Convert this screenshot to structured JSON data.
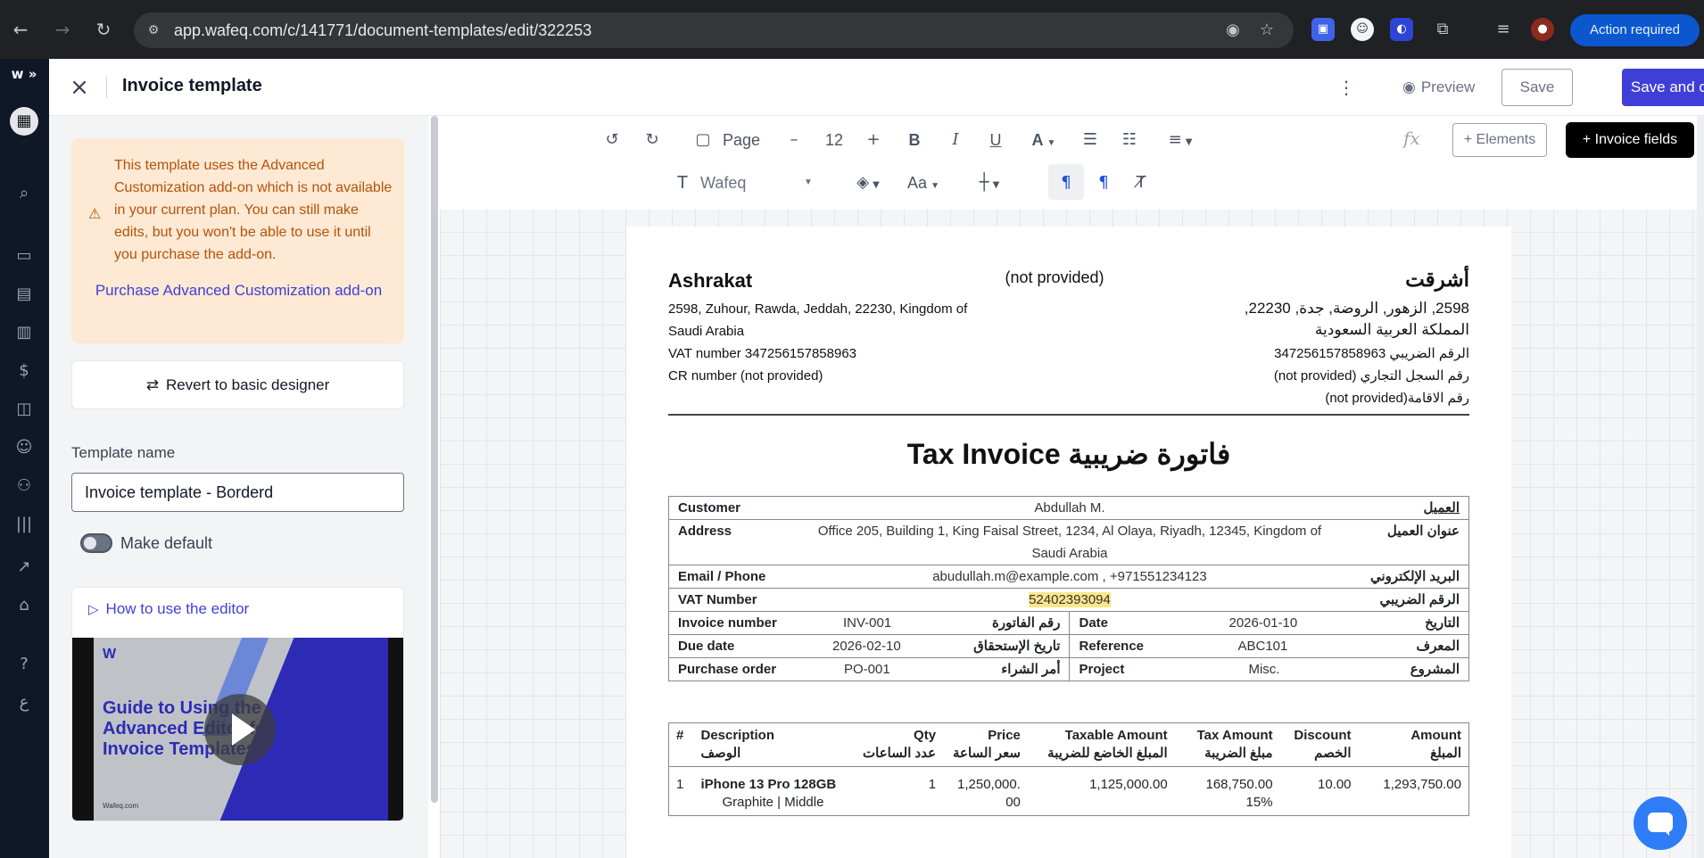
{
  "browser": {
    "url": "app.wafeq.com/c/141771/document-templates/edit/322253",
    "action_required": "Action required",
    "back_icon": "arrow-left-icon",
    "reload_icon": "reload-icon"
  },
  "header": {
    "title": "Invoice template",
    "preview_label": "Preview",
    "save_label": "Save",
    "save_close_label": "Save and close"
  },
  "sidebar": {
    "warning_text": "This template uses the Advanced Customization add-on which is not available in your current plan. You can still make edits, but you won't be able to use it until you purchase the add-on.",
    "purchase_link": "Purchase Advanced Customization add-on",
    "revert_label": "Revert to basic designer",
    "template_name_label": "Template name",
    "template_name_value": "Invoice template - Borderd",
    "make_default_label": "Make default",
    "make_default_on": false,
    "howto_label": "How to use the editor",
    "video_logo": "W",
    "video_title": "Guide to Using the Advanced Editor for Invoice Templates",
    "video_site": "Wafeq.com"
  },
  "toolbar": {
    "page_label": "Page",
    "font_size": "12",
    "font_family": "Wafeq",
    "case_label": "Aa",
    "elements_label": "+ Elements",
    "invoice_fields_label": "+ Invoice fields",
    "fx_label": "fx"
  },
  "doc": {
    "company_en": "Ashrakat",
    "company_ar": "أشرقت",
    "logo_placeholder": "(not provided)",
    "address_en_1": "2598, Zuhour, Rawda, Jeddah, 22230, Kingdom of",
    "address_en_2": "Saudi Arabia",
    "vat_en": "VAT number 347256157858963",
    "cr_en": "CR number (not provided)",
    "address_ar_1": "2598, الزهور, الروضة, جدة, 22230,",
    "address_ar_2": "المملكة العربية السعودية",
    "vat_ar": "الرقم الضريبي 347256157858963",
    "cr_ar": "رقم السجل التجاري (not provided)",
    "residency_ar": "رقم الاقامة(not provided)",
    "title": "Tax Invoice فاتورة ضريبية",
    "customer": {
      "label": "Customer",
      "label_ar": "العميل",
      "value": "Abdullah M."
    },
    "address": {
      "label": "Address",
      "label_ar": "عنوان العميل",
      "value": "Office 205, Building 1, King Faisal Street, 1234, Al Olaya, Riyadh, 12345, Kingdom of Saudi Arabia"
    },
    "email": {
      "label": "Email / Phone",
      "label_ar": "البريد الإلكتروني",
      "value": "abudullah.m@example.com , +971551234123"
    },
    "vat": {
      "label": "VAT Number",
      "label_ar": "الرقم الضريبي",
      "value": "52402393094"
    },
    "fields": [
      {
        "l": "Invoice number",
        "v": "INV-001",
        "la": "رقم الفاتورة",
        "l2": "Date",
        "v2": "2026-01-10",
        "la2": "التاريخ"
      },
      {
        "l": "Due date",
        "v": "2026-02-10",
        "la": "تاريخ الإستحقاق",
        "l2": "Reference",
        "v2": "ABC101",
        "la2": "المعرف"
      },
      {
        "l": "Purchase order",
        "v": "PO-001",
        "la": "أمر الشراء",
        "l2": "Project",
        "v2": "Misc.",
        "la2": "المشروع"
      }
    ],
    "items_header": {
      "num": "#",
      "desc": "Description",
      "desc_ar": "الوصف",
      "qty": "Qty",
      "qty_ar": "عدد الساعات",
      "price": "Price",
      "price_ar": "سعر الساعة",
      "taxable": "Taxable Amount",
      "taxable_ar": "المبلغ الخاضع للضريبة",
      "tax": "Tax Amount",
      "tax_ar": "مبلغ الضريبة",
      "discount": "Discount",
      "discount_ar": "الخصم",
      "amount": "Amount",
      "amount_ar": "المبلغ"
    },
    "items": [
      {
        "num": "1",
        "name": "iPhone 13 Pro 128GB",
        "detail": "Graphite | Middle",
        "qty": "1",
        "price": "1,250,000.00",
        "taxable": "1,125,000.00",
        "tax": "168,750.00",
        "tax_rate": "15%",
        "discount": "10.00",
        "amount": "1,293,750.00"
      }
    ]
  }
}
